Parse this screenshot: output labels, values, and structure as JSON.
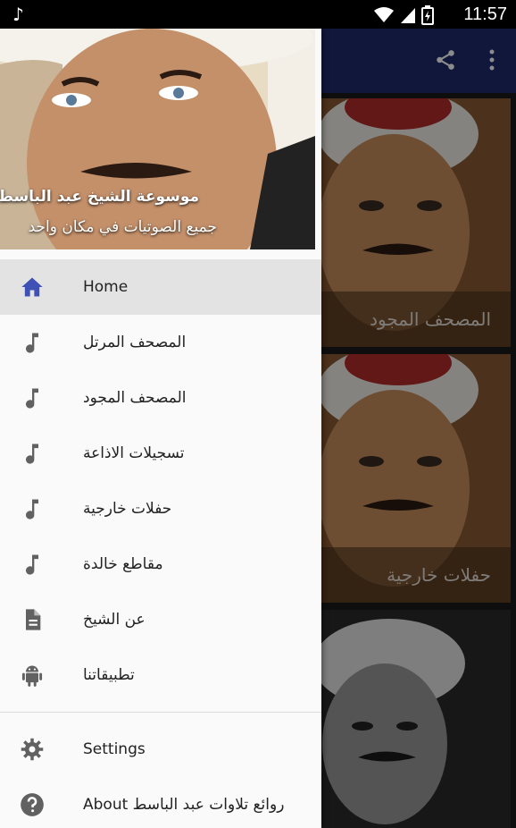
{
  "status_bar": {
    "time": "11:57"
  },
  "background": {
    "cards": [
      {
        "caption": "المصحف المجود"
      },
      {
        "caption": "حفلات خارجية"
      },
      {
        "caption": ""
      }
    ]
  },
  "drawer": {
    "header": {
      "title": "موسوعة الشيخ عبد الباسط",
      "subtitle": "جميع الصوتيات في مكان واحد"
    },
    "items": [
      {
        "label": "Home",
        "icon": "home-icon"
      },
      {
        "label": "المصحف المرتل",
        "icon": "music-note-icon"
      },
      {
        "label": "المصحف المجود",
        "icon": "music-note-icon"
      },
      {
        "label": "تسجيلات الاذاعة",
        "icon": "music-note-icon"
      },
      {
        "label": "حفلات خارجية",
        "icon": "music-note-icon"
      },
      {
        "label": "مقاطع خالدة",
        "icon": "music-note-icon"
      },
      {
        "label": "عن الشيخ",
        "icon": "document-icon"
      },
      {
        "label": "تطبيقاتنا",
        "icon": "android-icon"
      }
    ],
    "footer_items": [
      {
        "label": "Settings",
        "icon": "gear-icon"
      },
      {
        "label": "About روائع تلاوات عبد الباسط",
        "icon": "help-icon"
      }
    ]
  },
  "colors": {
    "accent": "#3f51b5",
    "appbar": "#1f2a6b",
    "active_bg": "#e3e3e3"
  }
}
